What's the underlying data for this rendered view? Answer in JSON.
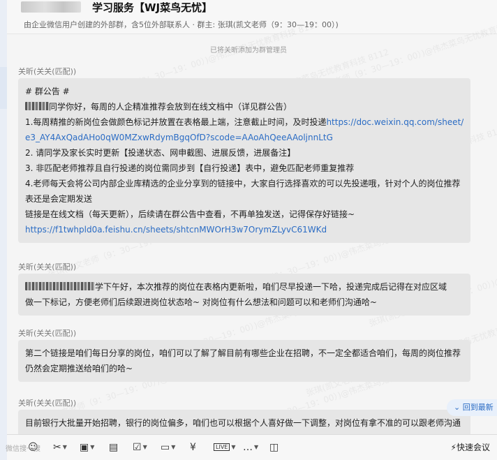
{
  "header": {
    "title": "学习服务【WJ菜鸟无忧】",
    "subtitle": "由企业微信用户创建的外部群，含5位外部联系人 · 群主: 张琪(凯文老师（9：30—19：00）)"
  },
  "system_notice": "已将关昕添加为群管理员",
  "watermark": {
    "text": "张琪(凯文老师（9：30—19：00）)@伟杰菜鸟无忧教育科技 8112"
  },
  "messages": [
    {
      "sender": "关昕(关关(匹配))",
      "lines": [
        {
          "text": "# 群公告 #"
        },
        {
          "masked_prefix": true,
          "text": "同学你好，每周的人企精准推荐会放到在线文档中（详见群公告）"
        },
        {
          "text": "1.每周精推的新岗位会做颜色标记并放置在表格最上端，注意截止时间，及时投递",
          "link": "https://doc.weixin.qq.com/sheet/"
        },
        {
          "link": "e3_AY4AxQadAHo0qW0MZxwRdymBgqOfD?scode=AAoAhQeeAAoljnnLtG"
        },
        {
          "text": "2. 请同学及家长实时更新【投递状态、网申截图、进展反馈，进展备注】"
        },
        {
          "text": "3. 非匹配老师推荐且自行投递的岗位需同步到【自行投递】表中，避免匹配老师重复推荐"
        },
        {
          "text": "4.老师每天会将公司内部企业库精选的企业分享到的链接中，大家自行选择喜欢的可以先投递哦，针对个人的岗位推荐"
        },
        {
          "text": "表还是会定期发送"
        },
        {
          "text": "链接是在线文档（每天更新），后续请在群公告中查看，不再单独发送，记得保存好链接~"
        },
        {
          "link": "https://f1twhpld0a.feishu.cn/sheets/shtcnMWOrH3w7OrymZLyvC61WKd"
        }
      ]
    },
    {
      "sender": "关昕(关关(匹配))",
      "lines": [
        {
          "masked_prefix": true,
          "text": "学下午好，本次推荐的岗位在表格内更新啦，咱们尽早投递一下哈，投递完成后记得在对应区域"
        },
        {
          "text": "做一下标记，方便老师们后续跟进岗位状态哈~ 对岗位有什么想法和问题可以和老师们沟通哈~"
        }
      ]
    },
    {
      "sender": "关昕(关关(匹配))",
      "lines": [
        {
          "text": "第二个链接是咱们每日分享的岗位，咱们可以了解了解目前有哪些企业在招聘，不一定全都适合咱们，每周的岗位推荐"
        },
        {
          "text": "仍然会定期推送给咱们的哈~"
        }
      ]
    },
    {
      "sender": "关昕(关关(匹配))",
      "lines": [
        {
          "text": "目前银行大批量开始招聘，银行的岗位偏多，咱们也可以根据个人喜好做一下调整，对岗位有拿不准的可以跟老师沟通"
        }
      ]
    }
  ],
  "back_to_bottom": "回到最新",
  "toolbar": {
    "items": [
      {
        "name": "emoji-icon",
        "glyph": "☺",
        "caret": false
      },
      {
        "name": "screenshot-icon",
        "glyph": "✂",
        "caret": true
      },
      {
        "name": "image-icon",
        "glyph": "▣",
        "caret": true
      },
      {
        "name": "document-icon",
        "glyph": "▤",
        "caret": false
      },
      {
        "name": "task-icon",
        "glyph": "☑",
        "caret": true
      },
      {
        "name": "folder-icon",
        "glyph": "▭",
        "caret": true
      },
      {
        "name": "payment-icon",
        "glyph": "¥",
        "caret": false
      },
      {
        "name": "live-icon",
        "glyph": "LIVE",
        "caret": true
      },
      {
        "name": "chat-bubble-icon",
        "glyph": "…",
        "caret": true
      },
      {
        "name": "history-icon",
        "glyph": "◫",
        "caret": false
      }
    ],
    "quick_meeting": "快速会议"
  },
  "brand_mark": "微信搜一搜"
}
